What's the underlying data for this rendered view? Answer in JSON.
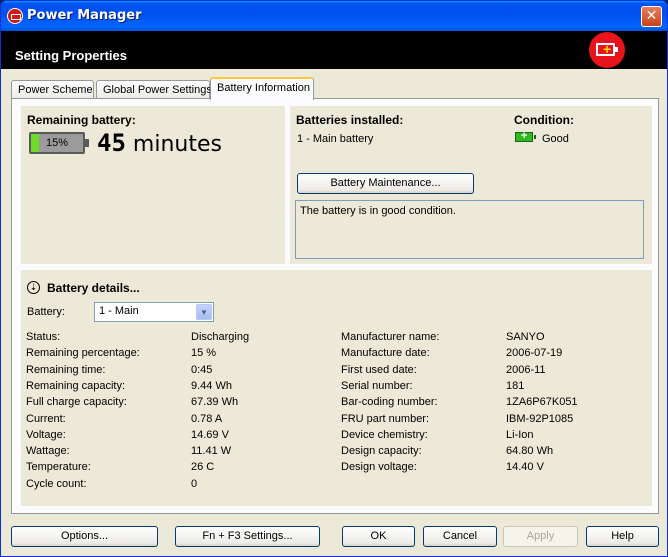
{
  "window": {
    "title": "Power Manager",
    "close_glyph": "✕"
  },
  "header": {
    "title": "Setting Properties",
    "logo_icon": "battery-plus-icon"
  },
  "tabs": [
    "Power Scheme",
    "Global Power Settings",
    "Battery Information"
  ],
  "remaining": {
    "label": "Remaining battery:",
    "percent_text": "15%",
    "percent_value": 15,
    "time_number": "45",
    "time_unit": "minutes"
  },
  "installed": {
    "label": "Batteries installed:",
    "value": "1 - Main battery",
    "condition_label": "Condition:",
    "condition_value": "Good",
    "maintenance_button": "Battery Maintenance...",
    "message": "The battery is in good condition."
  },
  "details": {
    "title": "Battery details...",
    "battery_label": "Battery:",
    "battery_select": "1 - Main",
    "left": [
      {
        "k": "Status:",
        "v": "Discharging"
      },
      {
        "k": "Remaining percentage:",
        "v": "15 %"
      },
      {
        "k": "Remaining time:",
        "v": "0:45"
      },
      {
        "k": "Remaining capacity:",
        "v": "9.44 Wh"
      },
      {
        "k": "Full charge capacity:",
        "v": "67.39 Wh"
      },
      {
        "k": "Current:",
        "v": "0.78 A"
      },
      {
        "k": "Voltage:",
        "v": "14.69 V"
      },
      {
        "k": "Wattage:",
        "v": "11.41 W"
      },
      {
        "k": "Temperature:",
        "v": "26 C"
      },
      {
        "k": "Cycle count:",
        "v": "0"
      }
    ],
    "right": [
      {
        "k": "Manufacturer name:",
        "v": "SANYO"
      },
      {
        "k": "Manufacture date:",
        "v": "2006-07-19"
      },
      {
        "k": "First used date:",
        "v": "2006-11"
      },
      {
        "k": "Serial number:",
        "v": "181"
      },
      {
        "k": "Bar-coding number:",
        "v": "1ZA6P67K051"
      },
      {
        "k": "FRU part number:",
        "v": "IBM-92P1085"
      },
      {
        "k": "Device chemistry:",
        "v": "Li-Ion"
      },
      {
        "k": "Design capacity:",
        "v": "64.80 Wh"
      },
      {
        "k": "Design voltage:",
        "v": "14.40 V"
      }
    ]
  },
  "buttons": {
    "options": "Options...",
    "fn_f3": "Fn + F3 Settings...",
    "ok": "OK",
    "cancel": "Cancel",
    "apply": "Apply",
    "help": "Help"
  },
  "colors": {
    "battery_fill": "#6fdc2a",
    "header_bg": "#000000",
    "logo_red": "#e8141c"
  }
}
